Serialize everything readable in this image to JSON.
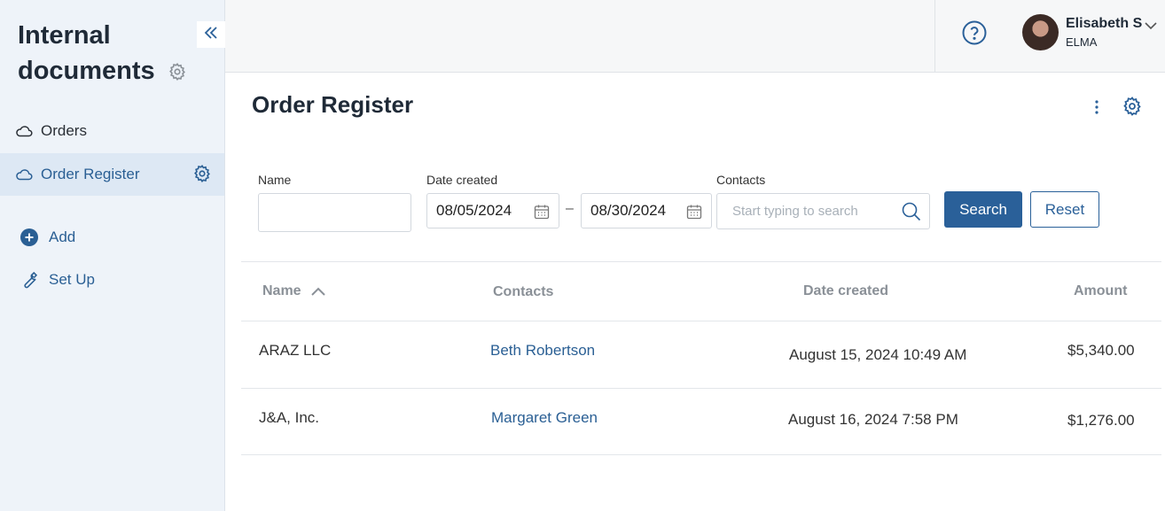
{
  "sidebar": {
    "app_title": "Internal documents",
    "items": [
      {
        "label": "Orders",
        "icon": "cloud-icon"
      },
      {
        "label": "Order Register",
        "icon": "cloud-icon",
        "active": true
      }
    ],
    "actions": [
      {
        "label": "Add",
        "icon": "plus-circle-icon"
      },
      {
        "label": "Set Up",
        "icon": "wrench-icon"
      }
    ]
  },
  "header": {
    "user_name": "Elisabeth S",
    "user_org": "ELMA"
  },
  "page": {
    "title": "Order Register"
  },
  "filters": {
    "name_label": "Name",
    "name_value": "",
    "date_label": "Date created",
    "date_from": "08/05/2024",
    "date_to": "08/30/2024",
    "contacts_label": "Contacts",
    "contacts_placeholder": "Start typing to search",
    "search_label": "Search",
    "reset_label": "Reset"
  },
  "table": {
    "columns": [
      "Name",
      "Contacts",
      "Date created",
      "Amount"
    ],
    "sort_column": "Name",
    "sort_direction": "ascending",
    "rows": [
      {
        "name": "ARAZ LLC",
        "contact": "Beth Robertson",
        "date": "August 15, 2024 10:49 AM",
        "amount": "$5,340.00"
      },
      {
        "name": "J&A, Inc.",
        "contact": "Margaret Green",
        "date": "August 16, 2024 7:58 PM",
        "amount": "$1,276.00"
      }
    ]
  },
  "colors": {
    "accent": "#2a6099",
    "sidebar_bg": "#eef3f9",
    "active_item_bg": "#dde8f4"
  }
}
